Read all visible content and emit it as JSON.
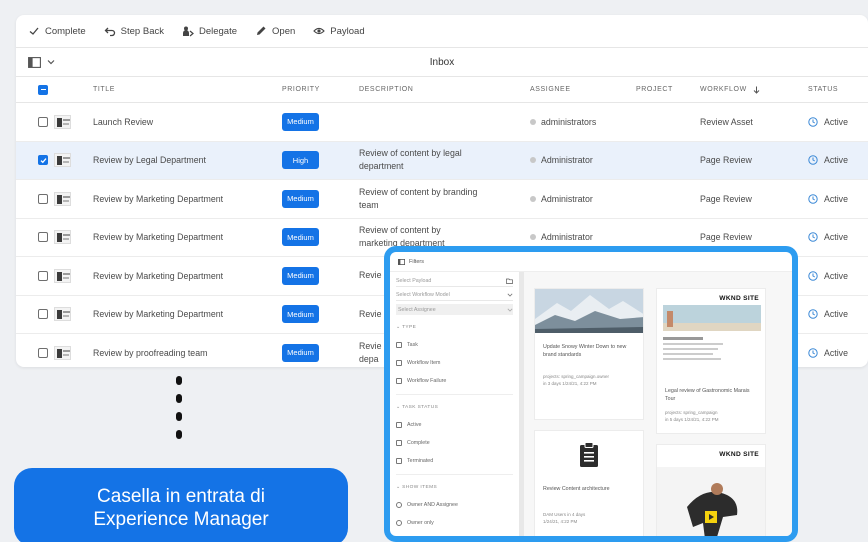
{
  "toolbar": {
    "actions": [
      {
        "label": "Complete",
        "icon": "checkmark-icon"
      },
      {
        "label": "Step Back",
        "icon": "undo-icon"
      },
      {
        "label": "Delegate",
        "icon": "delegate-icon"
      },
      {
        "label": "Open",
        "icon": "pencil-icon"
      },
      {
        "label": "Payload",
        "icon": "eye-icon"
      }
    ]
  },
  "subbar": {
    "title": "Inbox"
  },
  "table": {
    "columns": [
      "TITLE",
      "PRIORITY",
      "DESCRIPTION",
      "ASSIGNEE",
      "PROJECT",
      "WORKFLOW",
      "STATUS"
    ],
    "rows": [
      {
        "title": "Launch Review",
        "priority": "Medium",
        "description": "",
        "assignee": "administrators",
        "project": "",
        "workflow": "Review Asset",
        "status": "Active",
        "selected": false
      },
      {
        "title": "Review by Legal Department",
        "priority": "High",
        "description": "Review of content by legal department",
        "assignee": "Administrator",
        "project": "",
        "workflow": "Page Review",
        "status": "Active",
        "selected": true
      },
      {
        "title": "Review by Marketing Department",
        "priority": "Medium",
        "description": "Review of content by branding team",
        "assignee": "Administrator",
        "project": "",
        "workflow": "Page Review",
        "status": "Active",
        "selected": false
      },
      {
        "title": "Review by Marketing Department",
        "priority": "Medium",
        "description": "Review of content by marketing department",
        "assignee": "Administrator",
        "project": "",
        "workflow": "Page Review",
        "status": "Active",
        "selected": false
      },
      {
        "title": "Review by Marketing Department",
        "priority": "Medium",
        "description": "Revie",
        "assignee": "",
        "project": "",
        "workflow": "",
        "status": "Active",
        "selected": false
      },
      {
        "title": "Review by Marketing Department",
        "priority": "Medium",
        "description": "Revie",
        "assignee": "",
        "project": "",
        "workflow": "",
        "status": "Active",
        "selected": false
      },
      {
        "title": "Review by proofreading team",
        "priority": "Medium",
        "description": "Revie\ndepa",
        "assignee": "",
        "project": "",
        "workflow": "",
        "status": "Active",
        "selected": false
      }
    ]
  },
  "caption": {
    "line1": "Casella in entrata di",
    "line2": "Experience Manager"
  },
  "popup": {
    "header": "Filters",
    "fields": [
      "Select Payload",
      "Select Workflow Model",
      "Select Assignee"
    ],
    "sections": [
      {
        "label": "TYPE",
        "options": [
          "Task",
          "Workflow Item",
          "Workflow Failure"
        ],
        "kind": "checkbox"
      },
      {
        "label": "TASK STATUS",
        "options": [
          "Active",
          "Complete",
          "Terminated"
        ],
        "kind": "checkbox"
      },
      {
        "label": "SHOW ITEMS",
        "options": [
          "Owner AND Assignee",
          "Owner only"
        ],
        "kind": "radio"
      }
    ],
    "cards": {
      "c1": {
        "title": "Update Snowy Winter Down to new brand standards",
        "meta1": "projects: spring_campaign.owner",
        "meta2": "in 3 days  1/24/21, 4:22 PM"
      },
      "c2": {
        "brand": "WKND SITE",
        "title": "Legal review of Gastronomic Marais Tour",
        "meta1": "projects: spring_campaign",
        "meta2": "in 5 days  1/24/21, 4:22 PM"
      },
      "c3": {
        "title": "Review Content architecture",
        "meta1": "DAM Users  in 4 days",
        "meta2": "1/24/21, 4:22 PM"
      },
      "c4": {
        "brand": "WKND SITE"
      }
    }
  },
  "colors": {
    "accent": "#1473e6",
    "popup_border": "#2d9cf0"
  }
}
